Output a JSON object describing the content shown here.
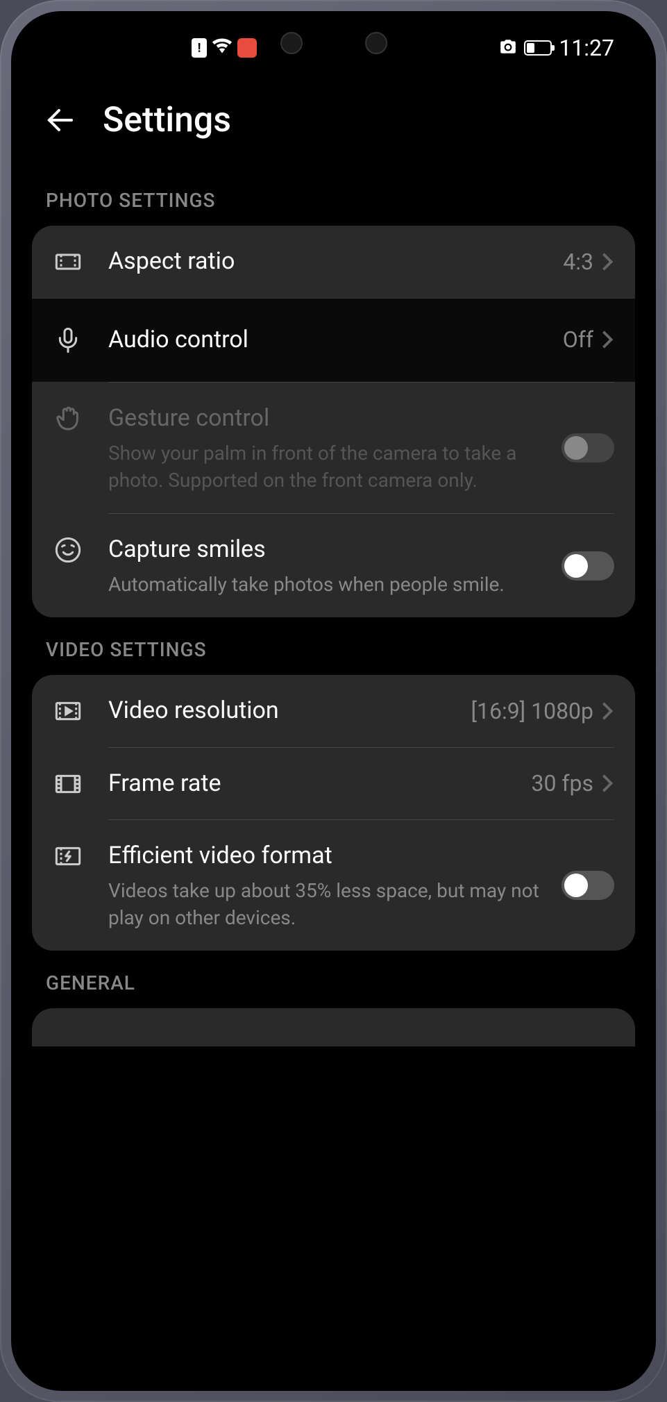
{
  "status_bar": {
    "time": "11:27"
  },
  "header": {
    "title": "Settings"
  },
  "sections": {
    "photo": {
      "header": "PHOTO SETTINGS",
      "items": {
        "aspect_ratio": {
          "label": "Aspect ratio",
          "value": "4:3"
        },
        "audio_control": {
          "label": "Audio control",
          "value": "Off"
        },
        "gesture_control": {
          "label": "Gesture control",
          "desc": "Show your palm in front of the camera to take a photo. Supported on the front camera only."
        },
        "capture_smiles": {
          "label": "Capture smiles",
          "desc": "Automatically take photos when people smile."
        }
      }
    },
    "video": {
      "header": "VIDEO SETTINGS",
      "items": {
        "resolution": {
          "label": "Video resolution",
          "value": "[16:9] 1080p"
        },
        "frame_rate": {
          "label": "Frame rate",
          "value": "30 fps"
        },
        "efficient_format": {
          "label": "Efficient video format",
          "desc": "Videos take up about 35% less space, but may not play on other devices."
        }
      }
    },
    "general": {
      "header": "GENERAL"
    }
  }
}
